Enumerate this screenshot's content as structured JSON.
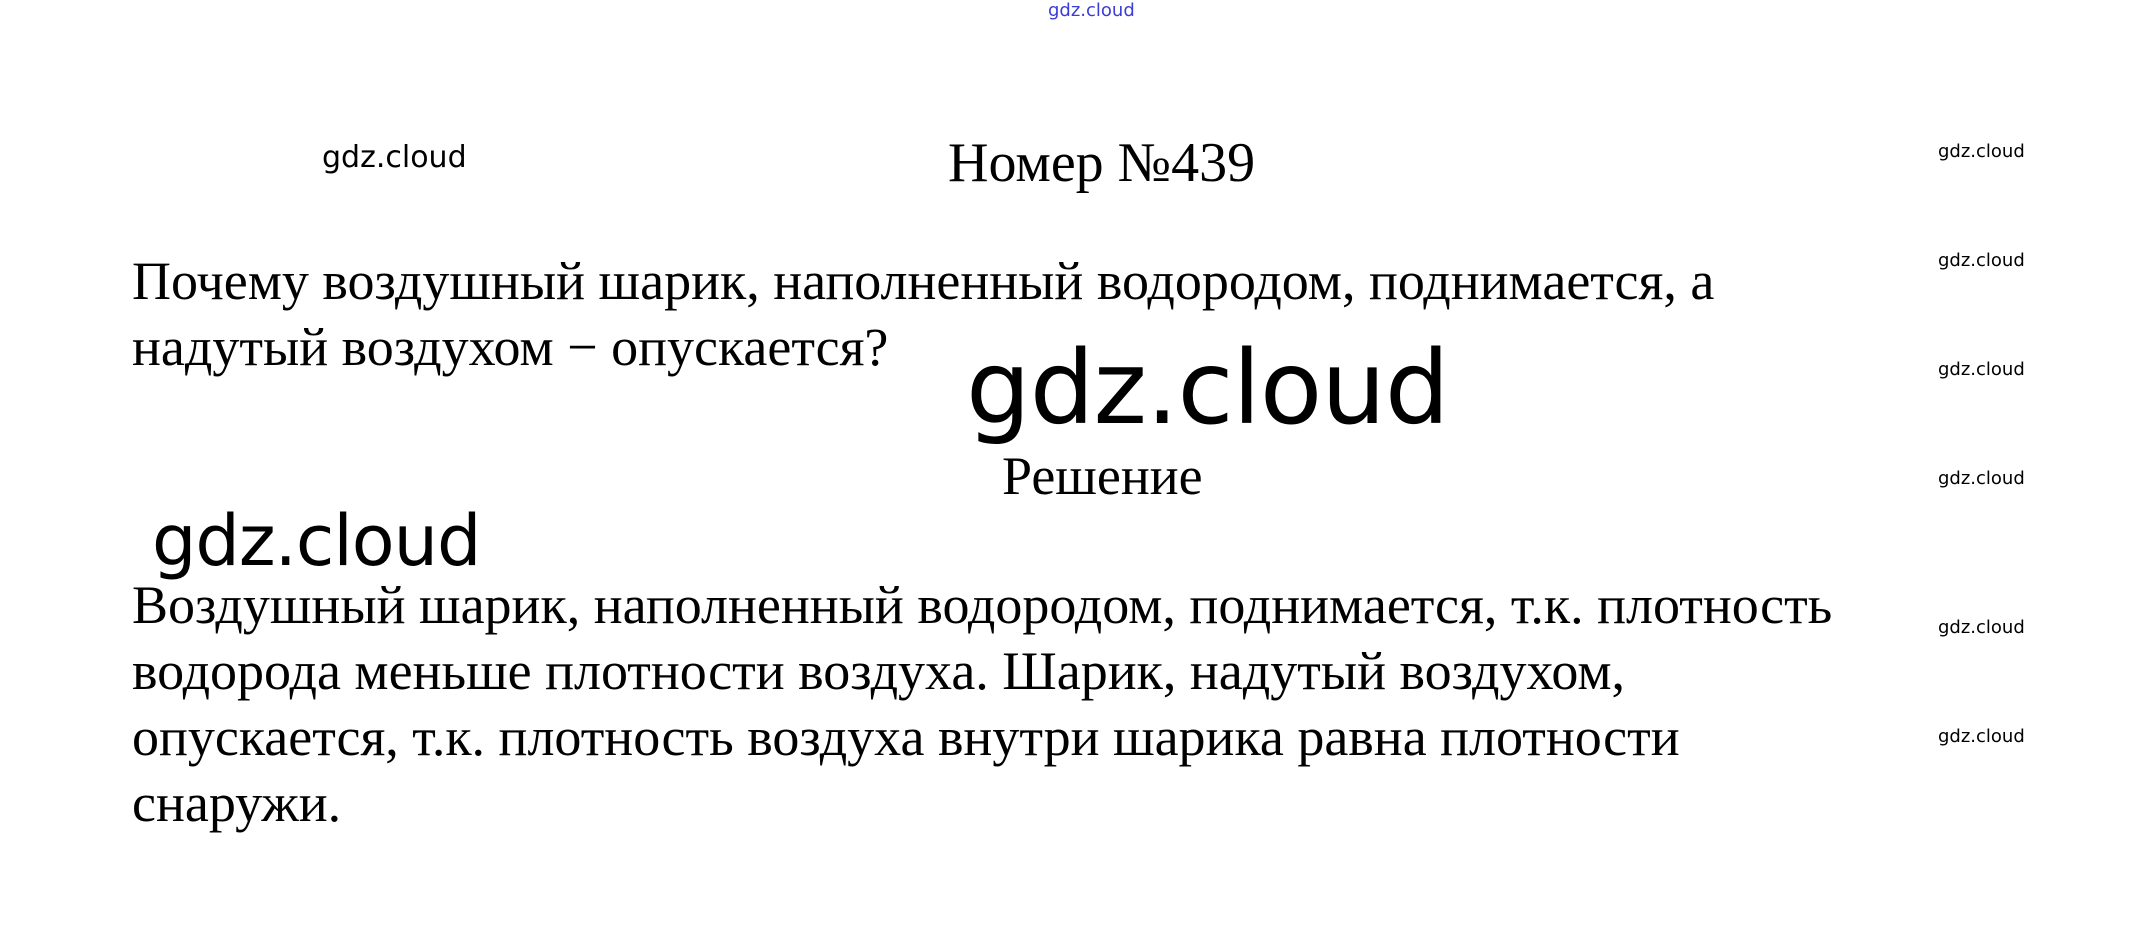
{
  "watermarks": {
    "top": "gdz.cloud",
    "medium": "gdz.cloud",
    "large": "gdz.cloud",
    "large_left": "gdz.cloud",
    "right_column": [
      "gdz.cloud",
      "gdz.cloud",
      "gdz.cloud",
      "gdz.cloud",
      "gdz.cloud",
      "gdz.cloud"
    ]
  },
  "title": "Номер №439",
  "question": {
    "lines": [
      "Почему воздушный шарик, наполненный водородом, поднимается, а",
      "надутый воздухом − опускается?"
    ]
  },
  "solution_heading": "Решение",
  "answer": {
    "lines": [
      "Воздушный шарик, наполненный водородом, поднимается, т.к. плотность",
      "водорода меньше плотности воздуха. Шарик, надутый воздухом,",
      "опускается, т.к. плотность воздуха внутри шарика равна плотности",
      "снаружи."
    ]
  }
}
